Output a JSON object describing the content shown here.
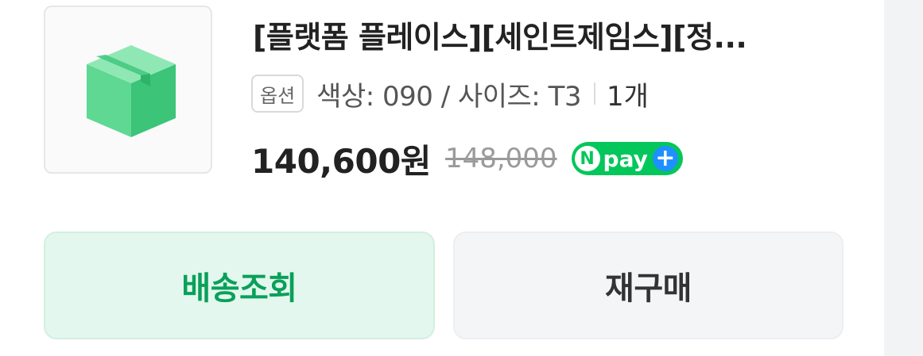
{
  "product": {
    "title": "[플랫폼 플레이스][세인트제임스][정...",
    "thumbnail_icon": "package-box-icon",
    "option_label": "옵션",
    "option_value": "색상: 090 / 사이즈: T3",
    "quantity": "1개",
    "price": "140,600원",
    "original_price": "148,000",
    "npay": {
      "n": "N",
      "text": "pay",
      "plus": "+"
    }
  },
  "actions": {
    "track_label": "배송조회",
    "rebuy_label": "재구매"
  },
  "colors": {
    "accent_green": "#0aa05a",
    "npay_green": "#03c75a",
    "track_bg": "#e3f7ee"
  }
}
